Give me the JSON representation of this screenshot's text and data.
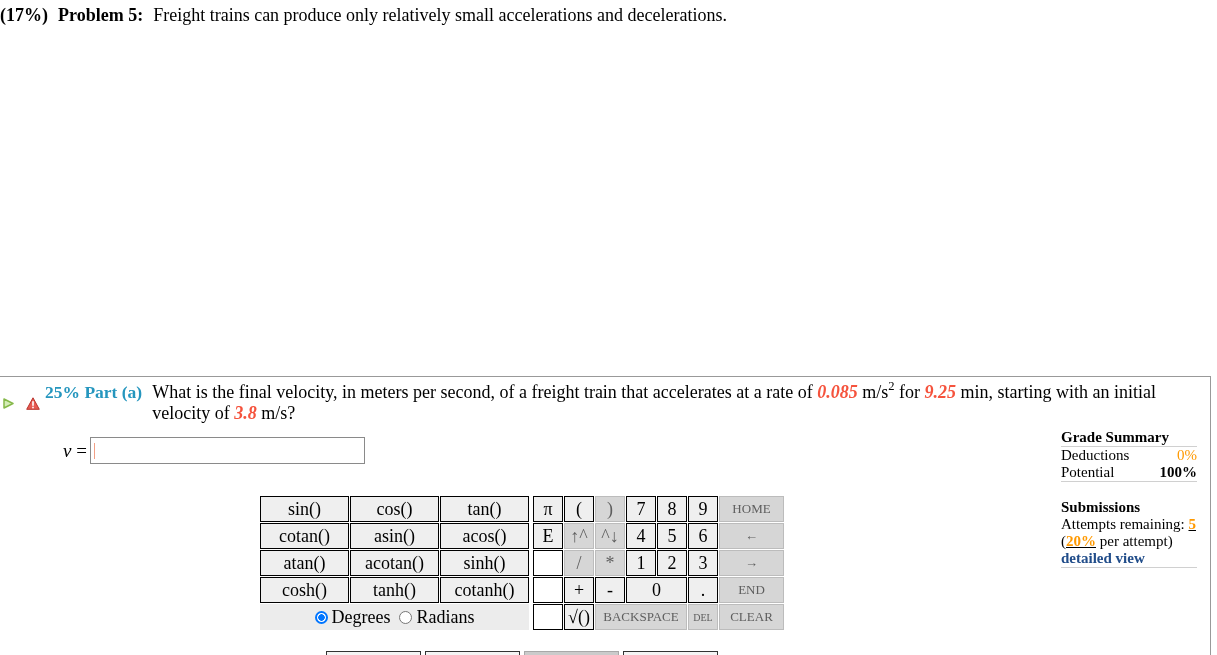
{
  "problem": {
    "weight": "(17%)",
    "label": "Problem 5:",
    "statement": "Freight trains can produce only relatively small accelerations and decelerations."
  },
  "part": {
    "label": "25% Part (a)",
    "warning": true,
    "question": [
      {
        "kind": "text",
        "text": "What is the final velocity, in meters per second, of a freight train that accelerates at a rate of "
      },
      {
        "kind": "value",
        "text": "0.085"
      },
      {
        "kind": "text",
        "text": " m/s$^{2}$ for "
      },
      {
        "kind": "value",
        "text": "9.25"
      },
      {
        "kind": "text",
        "text": " min, starting with an initial velocity of "
      },
      {
        "kind": "value",
        "text": "3.8"
      },
      {
        "kind": "text",
        "text": " m/s?"
      }
    ]
  },
  "answer": {
    "label": "*v* =",
    "focused": true
  },
  "grade_summary": {
    "title": "Grade Summary",
    "rows": [
      {
        "kind": "deduction",
        "label": "Deductions",
        "value": "0%"
      },
      {
        "kind": "potential",
        "label": "Potential",
        "value": "100%"
      }
    ]
  },
  "submissions": {
    "title": "Submissions",
    "lines": [
      [
        {
          "kind": "text",
          "text": "Attempts remaining: "
        },
        {
          "kind": "value",
          "text": "5"
        }
      ],
      [
        {
          "kind": "text",
          "text": "("
        },
        {
          "kind": "value",
          "text": "20%"
        },
        {
          "kind": "text",
          "text": " per attempt)"
        }
      ]
    ],
    "link": "detailed view"
  },
  "calculator": {
    "functions": [
      "sin()",
      "cos()",
      "tan()",
      "cotan()",
      "asin()",
      "acos()",
      "atan()",
      "acotan()",
      "sinh()",
      "cosh()",
      "tanh()",
      "cotanh()"
    ],
    "angle_modes": [
      {
        "label": "Degrees",
        "selected": true
      },
      {
        "label": "Radians",
        "selected": false
      }
    ],
    "keypad": [
      [
        {
          "kind": "key",
          "label": "π",
          "disabled": false
        },
        {
          "kind": "key",
          "label": "(",
          "disabled": false
        },
        {
          "kind": "key",
          "label": ")",
          "disabled": true
        },
        {
          "kind": "key",
          "label": "7",
          "disabled": false
        },
        {
          "kind": "key",
          "label": "8",
          "disabled": false
        },
        {
          "kind": "key",
          "label": "9",
          "disabled": false
        },
        {
          "kind": "word",
          "label": "HOME",
          "disabled": true
        }
      ],
      [
        {
          "kind": "key",
          "label": "E",
          "disabled": false
        },
        {
          "kind": "key",
          "label": "↑^",
          "disabled": true
        },
        {
          "kind": "key",
          "label": "^↓",
          "disabled": true
        },
        {
          "kind": "key",
          "label": "4",
          "disabled": false
        },
        {
          "kind": "key",
          "label": "5",
          "disabled": false
        },
        {
          "kind": "key",
          "label": "6",
          "disabled": false
        },
        {
          "kind": "word",
          "label": "←",
          "disabled": true
        }
      ],
      [
        {
          "kind": "blank"
        },
        {
          "kind": "key",
          "label": "/",
          "disabled": true
        },
        {
          "kind": "key",
          "label": "*",
          "disabled": true
        },
        {
          "kind": "key",
          "label": "1",
          "disabled": false
        },
        {
          "kind": "key",
          "label": "2",
          "disabled": false
        },
        {
          "kind": "key",
          "label": "3",
          "disabled": false
        },
        {
          "kind": "word",
          "label": "→",
          "disabled": true
        }
      ],
      [
        {
          "kind": "blank"
        },
        {
          "kind": "key",
          "label": "+",
          "disabled": false
        },
        {
          "kind": "key",
          "label": "-",
          "disabled": false
        },
        {
          "kind": "key",
          "label": "0",
          "disabled": false
        },
        {
          "kind": "key",
          "label": ".",
          "disabled": false
        },
        {
          "kind": "word",
          "label": "END",
          "disabled": true
        }
      ],
      [
        {
          "kind": "blank"
        },
        {
          "kind": "key",
          "label": "√()",
          "disabled": false
        },
        {
          "kind": "word",
          "label": "BACKSPACE",
          "disabled": true
        },
        {
          "kind": "small",
          "label": "DEL",
          "disabled": true
        },
        {
          "kind": "word",
          "label": "CLEAR",
          "disabled": true
        }
      ]
    ]
  },
  "action_buttons": [
    {
      "disabled": false
    },
    {
      "disabled": false
    },
    {
      "disabled": true
    },
    {
      "disabled": false
    }
  ]
}
